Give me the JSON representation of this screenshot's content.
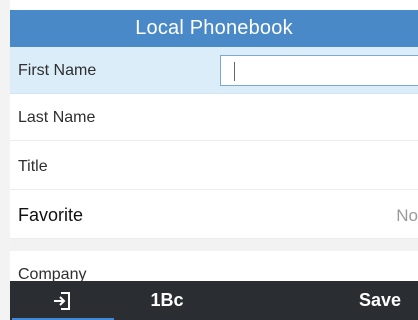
{
  "header": {
    "title": "Local Phonebook"
  },
  "fields": [
    {
      "label": "First Name",
      "value": ""
    },
    {
      "label": "Last Name",
      "value": ""
    },
    {
      "label": "Title",
      "value": ""
    },
    {
      "label": "Favorite",
      "value": "No"
    },
    {
      "label": "Company",
      "value": ""
    }
  ],
  "softkeys": {
    "back_icon": "back-exit-icon",
    "input_mode_label": "1Bc",
    "save_label": "Save"
  },
  "colors": {
    "title_bar": "#4a89c7",
    "selected_row": "#dcedfa",
    "softkey_bar": "#2a2e32",
    "accent": "#3f89d8"
  }
}
